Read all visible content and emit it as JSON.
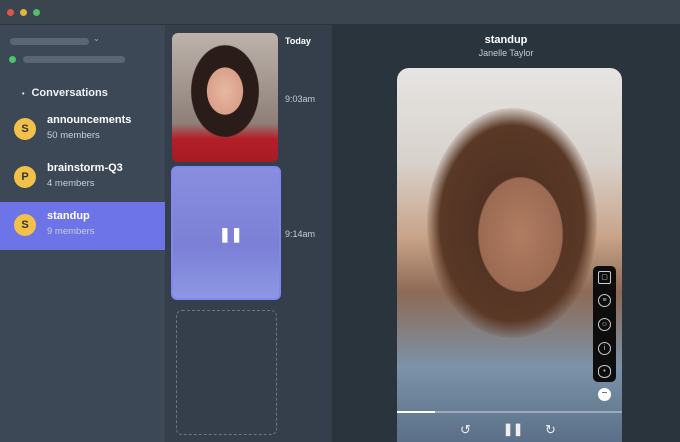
{
  "window": {
    "controls": [
      "close",
      "minimize",
      "maximize"
    ]
  },
  "sidebar": {
    "section_label": "Conversations",
    "conversations": [
      {
        "initial": "S",
        "name": "announcements",
        "members": "50 members"
      },
      {
        "initial": "P",
        "name": "brainstorm-Q3",
        "members": "4 members"
      },
      {
        "initial": "S",
        "name": "standup",
        "members": "9 members",
        "active": true
      }
    ]
  },
  "timeline": {
    "day_label": "Today",
    "times": [
      "9:03am",
      "9:14am"
    ]
  },
  "viewer": {
    "title": "standup",
    "author": "Janelle Taylor",
    "progress": 0.17
  },
  "colors": {
    "accent": "#6c74e8",
    "avatar": "#f2c14a"
  }
}
